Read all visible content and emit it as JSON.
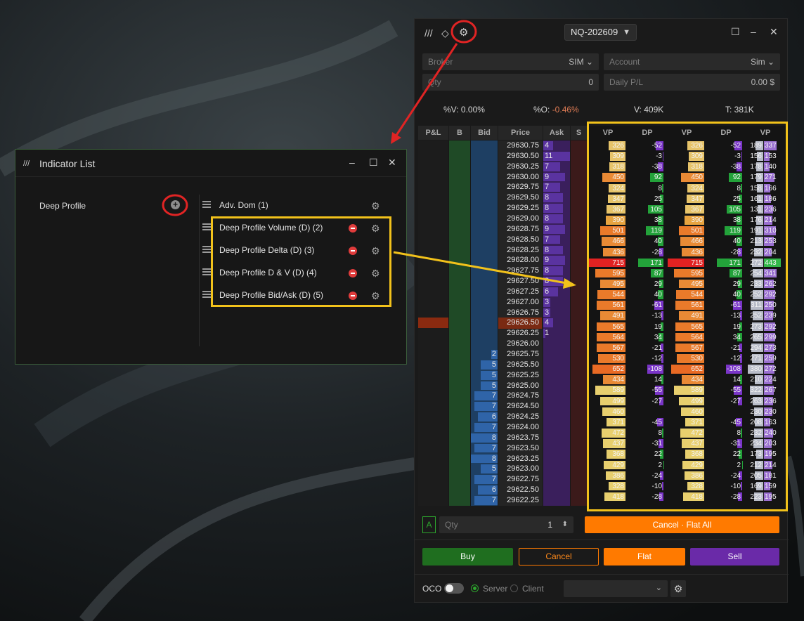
{
  "dom": {
    "title_icons": [
      "logo-icon",
      "eraser-icon",
      "gear-icon"
    ],
    "symbol": "NQ-202609",
    "broker": {
      "label": "Broker",
      "value": "SIM"
    },
    "account": {
      "label": "Account",
      "value": "Sim"
    },
    "qty": {
      "label": "Qty",
      "value": "0"
    },
    "daily_pl": {
      "label": "Daily P/L",
      "value": "0.00 $"
    },
    "stats": {
      "v_pct": "%V: 0.00%",
      "o_label": "%O:",
      "o_value": "-0.46%",
      "v": "V: 409K",
      "t": "T: 381K"
    },
    "headers": [
      "P&L",
      "B",
      "Bid",
      "Price",
      "Ask",
      "S"
    ],
    "profile_headers": [
      "VP",
      "DP",
      "VP",
      "DP",
      "VP"
    ],
    "prices": [
      "29630.75",
      "29630.50",
      "29630.25",
      "29630.00",
      "29629.75",
      "29629.50",
      "29629.25",
      "29629.00",
      "29628.75",
      "29628.50",
      "29628.25",
      "29628.00",
      "29627.75",
      "29627.50",
      "29627.25",
      "29627.00",
      "29626.75",
      "29626.50",
      "29626.25",
      "29626.00",
      "29625.75",
      "29625.50",
      "29625.25",
      "29625.00",
      "29624.75",
      "29624.50",
      "29624.25",
      "29624.00",
      "29623.75",
      "29623.50",
      "29623.25",
      "29623.00",
      "29622.75",
      "29622.50",
      "29622.25"
    ],
    "ask": [
      "4",
      "11",
      "7",
      "9",
      "7",
      "8",
      "8",
      "8",
      "9",
      "7",
      "8",
      "9",
      "8",
      "8",
      "6",
      "3",
      "3",
      "4",
      "1",
      "",
      "",
      "",
      "",
      "",
      "",
      "",
      "",
      "",
      "",
      "",
      "",
      "",
      "",
      "",
      ""
    ],
    "bid": [
      "",
      "",
      "",
      "",
      "",
      "",
      "",
      "",
      "",
      "",
      "",
      "",
      "",
      "",
      "",
      "",
      "",
      "",
      "",
      "",
      "2",
      "5",
      "5",
      "5",
      "7",
      "7",
      "6",
      "7",
      "8",
      "7",
      "8",
      "5",
      "7",
      "6",
      "7"
    ],
    "vp": [
      "326",
      "309",
      "318",
      "450",
      "324",
      "347",
      "367",
      "390",
      "501",
      "466",
      "436",
      "715",
      "595",
      "495",
      "544",
      "561",
      "491",
      "565",
      "564",
      "567",
      "530",
      "652",
      "434",
      "589",
      "499",
      "460",
      "371",
      "472",
      "437",
      "368",
      "429",
      "386",
      "328",
      "418",
      ""
    ],
    "dp": [
      "-52",
      "-3",
      "-38",
      "92",
      "8",
      "25",
      "105",
      "38",
      "119",
      "40",
      "-28",
      "171",
      "87",
      "29",
      "40",
      "-61",
      "-13",
      "19",
      "34",
      "-21",
      "-12",
      "-108",
      "14",
      "-55",
      "-27",
      "",
      "-45",
      "8",
      "-31",
      "22",
      "2",
      "-24",
      "-10",
      "-28",
      ""
    ],
    "vp2_left": [
      "189",
      "156",
      "178",
      "179",
      "158",
      "161",
      "131",
      "176",
      "191",
      "213",
      "232",
      "272",
      "254",
      "233",
      "252",
      "311",
      "252",
      "273",
      "265",
      "294",
      "271",
      "380",
      "210",
      "322",
      "263",
      "230",
      "208",
      "232",
      "234",
      "173",
      "212",
      "205",
      "169",
      "223",
      ""
    ],
    "vp2_right": [
      "337",
      "153",
      "140",
      "271",
      "166",
      "186",
      "236",
      "214",
      "310",
      "253",
      "204",
      "443",
      "341",
      "262",
      "292",
      "250",
      "239",
      "292",
      "299",
      "273",
      "259",
      "272",
      "224",
      "267",
      "236",
      "230",
      "163",
      "240",
      "203",
      "195",
      "214",
      "181",
      "159",
      "195",
      ""
    ],
    "order": {
      "mode": "A",
      "qty_label": "Qty",
      "qty_value": "1",
      "cancel_flat": "Cancel · Flat All"
    },
    "buttons": {
      "buy": "Buy",
      "cancel": "Cancel",
      "flat": "Flat",
      "sell": "Sell"
    },
    "footer": {
      "oco": "OCO",
      "server": "Server",
      "client": "Client"
    },
    "colors": {
      "buy": "#1f6e1f",
      "flat": "#ff7a00",
      "sell": "#6a2aa8",
      "highlight": "#f2c21b",
      "annotation": "#e02424"
    }
  },
  "indicator_list": {
    "title": "Indicator List",
    "available": "Deep Profile",
    "items": [
      {
        "label": "Adv. Dom (1)",
        "removable": false
      },
      {
        "label": "Deep Profile Volume (D) (2)",
        "removable": true
      },
      {
        "label": "Deep Profile Delta (D) (3)",
        "removable": true
      },
      {
        "label": "Deep Profile D & V (D) (4)",
        "removable": true
      },
      {
        "label": "Deep Profile Bid/Ask (D) (5)",
        "removable": true
      }
    ]
  }
}
